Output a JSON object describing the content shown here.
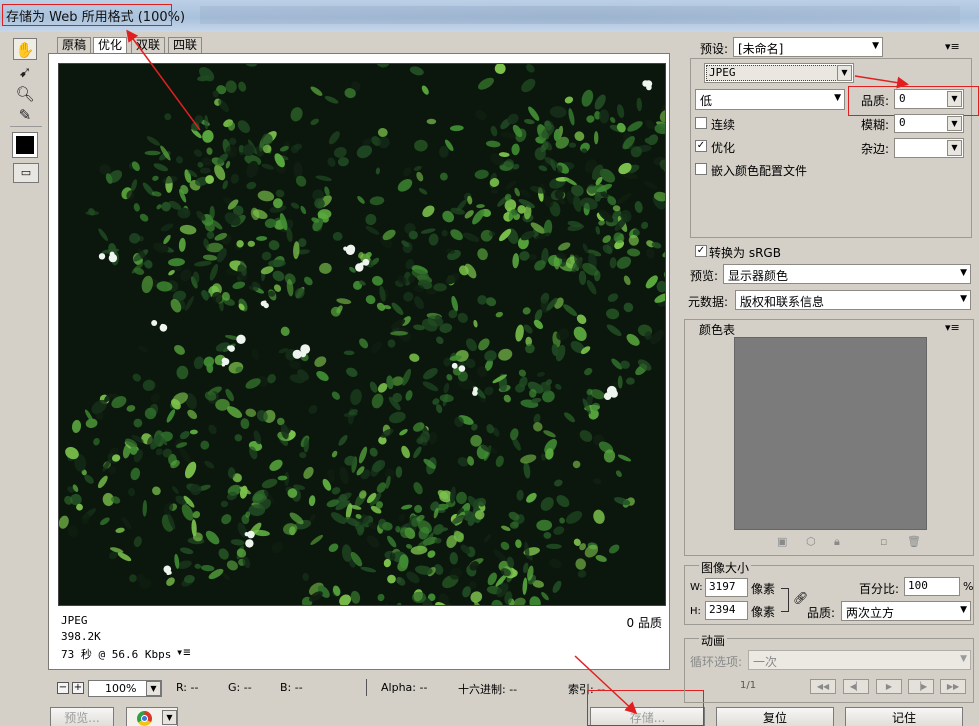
{
  "window": {
    "title": "存储为 Web 所用格式 (100%)"
  },
  "tabs": [
    {
      "label": "原稿",
      "active": false
    },
    {
      "label": "优化",
      "active": true
    },
    {
      "label": "双联",
      "active": false
    },
    {
      "label": "四联",
      "active": false
    }
  ],
  "image_info": {
    "format": "JPEG",
    "size": "398.2K",
    "time": "73 秒 @ 56.6 Kbps",
    "quality": "0 品质"
  },
  "status_bar": {
    "zoom": "100%",
    "r": "R: --",
    "g": "G: --",
    "b": "B: --",
    "alpha": "Alpha: --",
    "hex": "十六进制: --",
    "index": "索引: --"
  },
  "bottom_buttons": {
    "preview": "预览...",
    "save": "存储...",
    "reset": "复位",
    "remember": "记住"
  },
  "settings": {
    "preset_label": "预设:",
    "preset_value": "[未命名]",
    "format_value": "JPEG",
    "quality_level": "低",
    "quality_label": "品质:",
    "quality_value": "0",
    "progressive_label": "连续",
    "progressive_checked": false,
    "blur_label": "模糊:",
    "blur_value": "0",
    "optimized_label": "优化",
    "optimized_checked": true,
    "matte_label": "杂边:",
    "embed_profile_label": "嵌入颜色配置文件",
    "embed_profile_checked": false,
    "convert_srgb_label": "转换为 sRGB",
    "convert_srgb_checked": true,
    "preview_label": "预览:",
    "preview_value": "显示器颜色",
    "metadata_label": "元数据:",
    "metadata_value": "版权和联系信息"
  },
  "color_table": {
    "title": "颜色表",
    "swatch_color": "#7b7b7b"
  },
  "image_size": {
    "title": "图像大小",
    "w_label": "W:",
    "w_value": "3197",
    "h_label": "H:",
    "h_value": "2394",
    "unit": "像素",
    "percent_label": "百分比:",
    "percent_value": "100",
    "percent_unit": "%",
    "quality_label": "品质:",
    "quality_value": "两次立方"
  },
  "animation": {
    "title": "动画",
    "loop_label": "循环选项:",
    "loop_value": "一次",
    "frame": "1/1"
  },
  "colors": {
    "annotation": "#e02020",
    "dialog_bg": "#d4d0c8"
  }
}
